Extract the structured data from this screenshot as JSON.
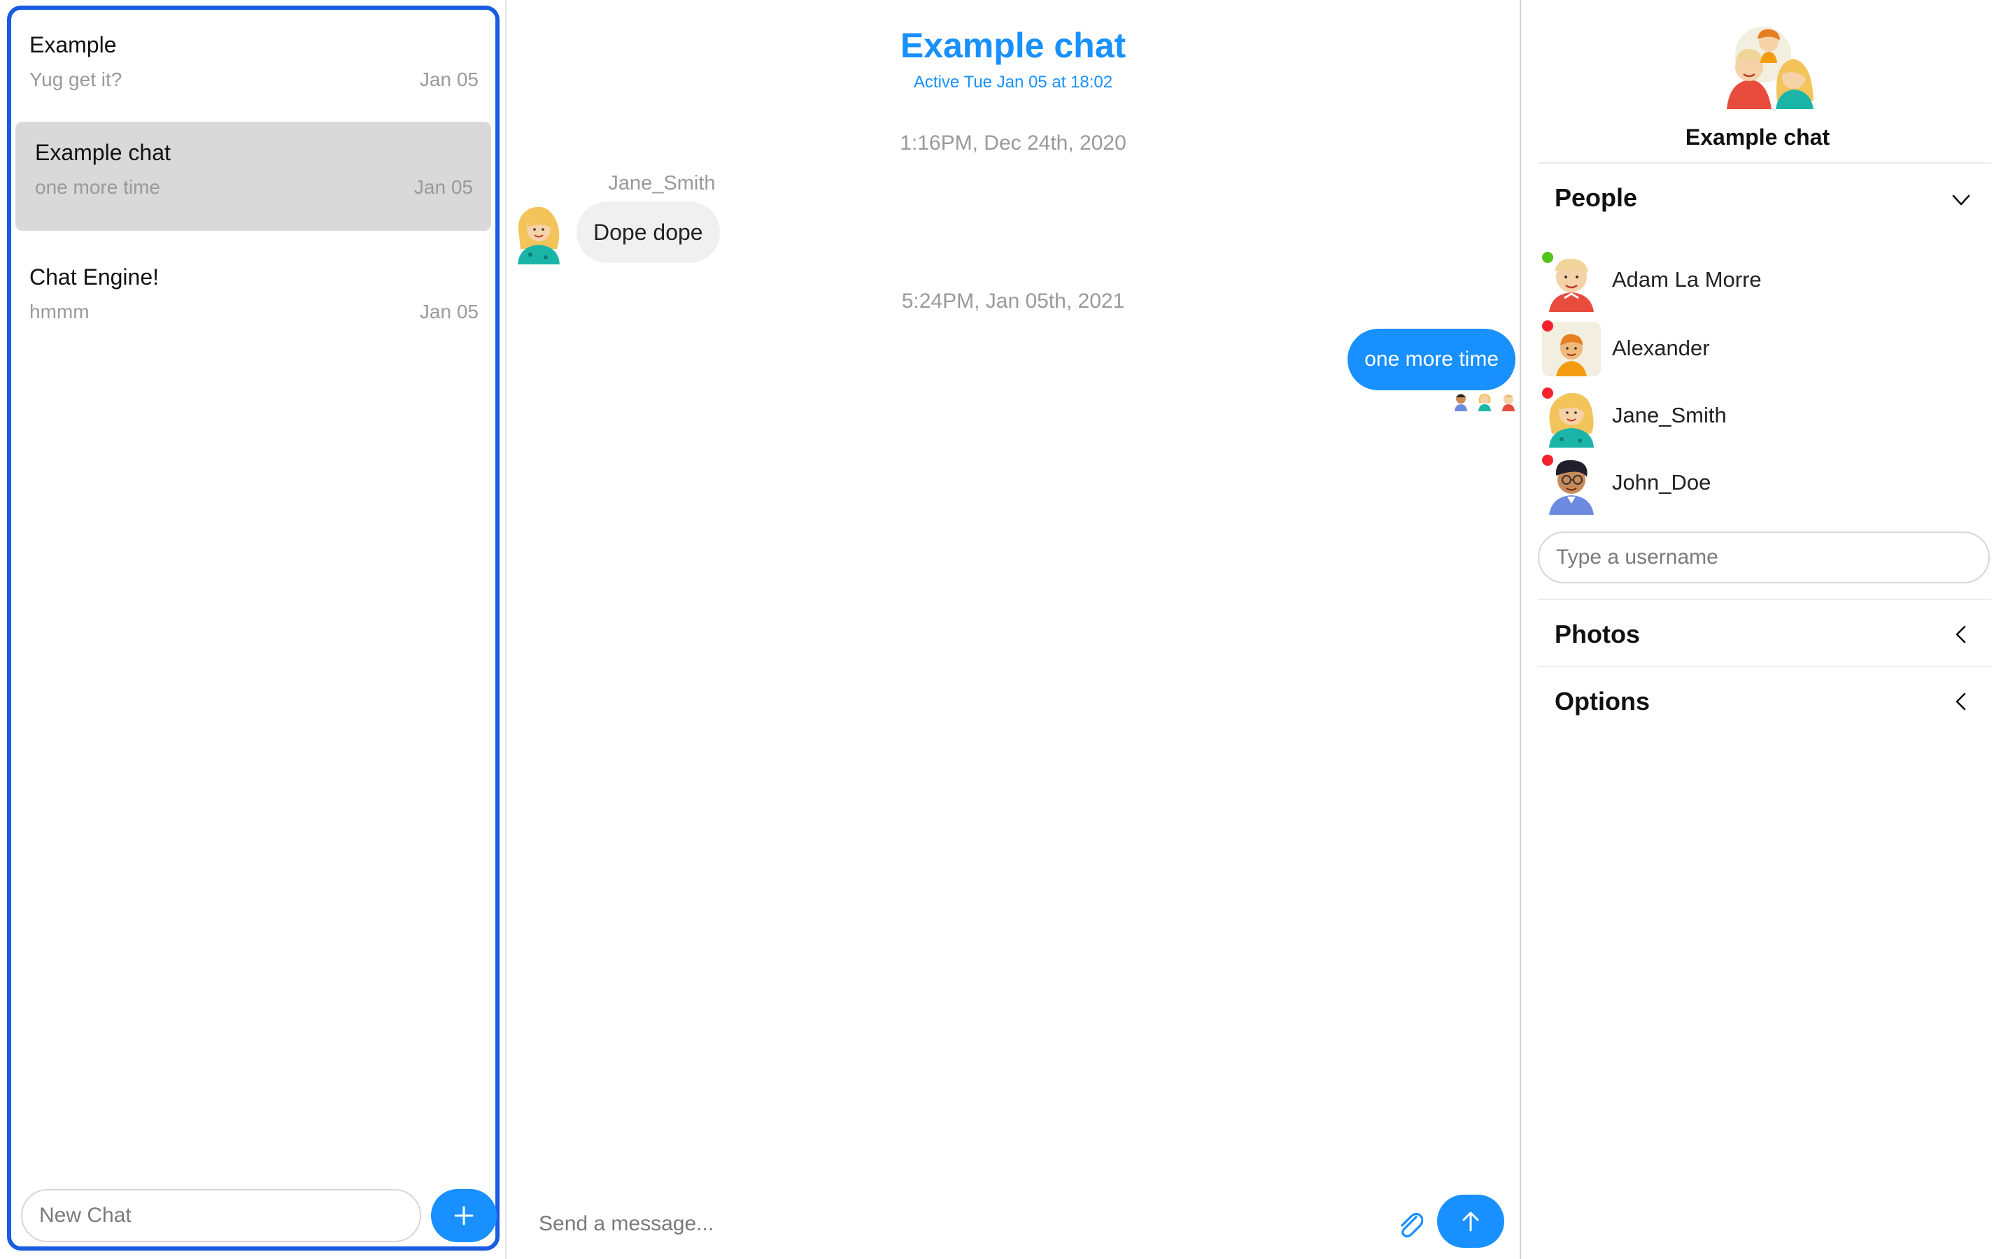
{
  "chat_list": {
    "chats": [
      {
        "title": "Example",
        "preview": "Yug get it?",
        "date": "Jan 05",
        "active": false
      },
      {
        "title": "Example chat",
        "preview": "one more time",
        "date": "Jan 05",
        "active": true
      },
      {
        "title": "Chat Engine!",
        "preview": "hmmm",
        "date": "Jan 05",
        "active": false
      }
    ],
    "new_chat_placeholder": "New Chat",
    "new_chat_button_icon": "plus-icon"
  },
  "feed": {
    "title": "Example chat",
    "subtitle": "Active Tue Jan 05 at 18:02",
    "timestamps": [
      "1:16PM, Dec 24th, 2020",
      "5:24PM, Jan 05th, 2021"
    ],
    "messages": [
      {
        "sender": "Jane_Smith",
        "text": "Dope dope",
        "mine": false
      },
      {
        "sender": "",
        "text": "one more time",
        "mine": true
      }
    ],
    "composer": {
      "placeholder": "Send a message...",
      "attach_icon": "paperclip-icon",
      "send_icon": "arrow-up-icon"
    }
  },
  "settings": {
    "title": "Example chat",
    "sections": {
      "people": "People",
      "photos": "Photos",
      "options": "Options"
    },
    "people": [
      {
        "name": "Adam La Morre",
        "online": true
      },
      {
        "name": "Alexander",
        "online": false
      },
      {
        "name": "Jane_Smith",
        "online": false
      },
      {
        "name": "John_Doe",
        "online": false
      }
    ],
    "username_placeholder": "Type a username"
  },
  "colors": {
    "accent": "#1890ff",
    "list_border": "#1a5ce0",
    "active_card": "#d9d9d9",
    "online": "#52c41a",
    "offline": "#f5222d"
  }
}
